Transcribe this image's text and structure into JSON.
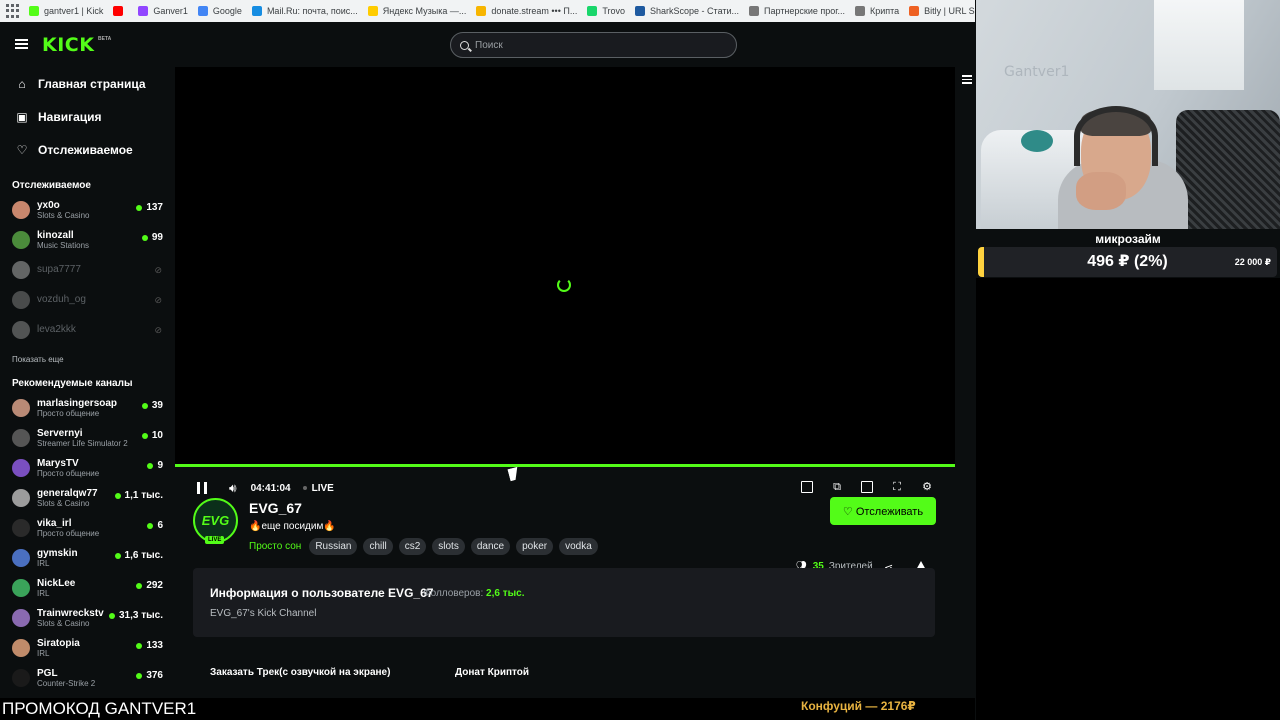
{
  "bookmarks": [
    {
      "label": "gantver1 | Kick",
      "color": "#53fc18"
    },
    {
      "label": "",
      "color": "#ff0000"
    },
    {
      "label": "Ganver1",
      "color": "#9146ff"
    },
    {
      "label": "Google",
      "color": "#4285f4"
    },
    {
      "label": "Mail.Ru: почта, поис...",
      "color": "#168de2"
    },
    {
      "label": "Яндекс Музыка —...",
      "color": "#ffcc00"
    },
    {
      "label": "donate.stream ••• П...",
      "color": "#f7b500"
    },
    {
      "label": "Trovo",
      "color": "#19d66b"
    },
    {
      "label": "SharkScope - Стати...",
      "color": "#1e5aa0"
    },
    {
      "label": "Партнерские прог...",
      "color": "#777777"
    },
    {
      "label": "Крипта",
      "color": "#777777"
    },
    {
      "label": "Bitly | URL Shortene...",
      "color": "#ee6123"
    }
  ],
  "header": {
    "logo": "KICK",
    "logo_badge": "BETA",
    "search_placeholder": "Поиск"
  },
  "sidebar": {
    "nav": [
      {
        "label": "Главная страница",
        "icon": "home-icon"
      },
      {
        "label": "Навигация",
        "icon": "browse-icon"
      },
      {
        "label": "Отслеживаемое",
        "icon": "heart-icon"
      }
    ],
    "following_title": "Отслеживаемое",
    "following": [
      {
        "name": "yx0o",
        "category": "Slots & Casino",
        "viewers": "137",
        "online": true,
        "color": "#c9876d"
      },
      {
        "name": "kinozall",
        "category": "Music Stations",
        "viewers": "99",
        "online": true,
        "color": "#4b8b3b"
      },
      {
        "name": "supa7777",
        "category": "",
        "viewers": "",
        "online": false,
        "color": "#bbbbbb"
      },
      {
        "name": "vozduh_og",
        "category": "",
        "viewers": "",
        "online": false,
        "color": "#888888"
      },
      {
        "name": "leva2kkk",
        "category": "",
        "viewers": "",
        "online": false,
        "color": "#999999"
      }
    ],
    "show_more": "Показать еще",
    "recommended_title": "Рекомендуемые каналы",
    "recommended": [
      {
        "name": "marlasingersoap",
        "category": "Просто общение",
        "viewers": "39",
        "color": "#b98a76"
      },
      {
        "name": "Servernyi",
        "category": "Streamer Life Simulator 2",
        "viewers": "10",
        "color": "#555555"
      },
      {
        "name": "MarysTV",
        "category": "Просто общение",
        "viewers": "9",
        "color": "#7a4fc0"
      },
      {
        "name": "generalqw77",
        "category": "Slots & Casino",
        "viewers": "1,1 тыс.",
        "color": "#9c9c9c"
      },
      {
        "name": "vika_irl",
        "category": "Просто общение",
        "viewers": "6",
        "color": "#2a2a2a"
      },
      {
        "name": "gymskin",
        "category": "IRL",
        "viewers": "1,6 тыс.",
        "color": "#4a6fc0"
      },
      {
        "name": "NickLee",
        "category": "IRL",
        "viewers": "292",
        "color": "#3aa35a"
      },
      {
        "name": "Trainwreckstv",
        "category": "Slots & Casino",
        "viewers": "31,3 тыс.",
        "color": "#8a6ab0"
      },
      {
        "name": "Siratopia",
        "category": "IRL",
        "viewers": "133",
        "color": "#c08b6a"
      },
      {
        "name": "PGL",
        "category": "Counter-Strike 2",
        "viewers": "376",
        "color": "#1a1a1a"
      }
    ]
  },
  "player": {
    "time": "04:41:04",
    "live_label": "LIVE",
    "progress": 1.0
  },
  "channel": {
    "name": "EVG_67",
    "avatar_text": "EVG",
    "live_badge": "LIVE",
    "title": "🔥еще посидим🔥",
    "category": "Просто сон",
    "tags": [
      "Russian",
      "chill",
      "cs2",
      "slots",
      "dance",
      "poker",
      "vodka"
    ],
    "follow_label": "♡ Отслеживать",
    "viewers": "35",
    "viewers_label": "Зрителей"
  },
  "about": {
    "title": "Информация о пользователе EVG_67",
    "followers_label": "Фолловеров:",
    "followers_value": "2,6 тыс.",
    "description": "EVG_67's Kick Channel"
  },
  "panels": {
    "panel_a": "Заказать Трек(с озвучкой на экране)",
    "panel_b": "Донат Криптой"
  },
  "overlay": {
    "webcam_wall_text": "Gantver1",
    "donation_label": "микрозайм",
    "donation_amount": "496 ₽ (2%)",
    "donation_goal": "22 000 ₽",
    "donation_progress": 0.02,
    "promo": "ПРОМОКОД GANTVER1",
    "ticker": "Конфуций — 2176₽"
  },
  "colors": {
    "accent": "#53fc18",
    "background": "#0b0e0f",
    "donation": "#ffd23f"
  }
}
